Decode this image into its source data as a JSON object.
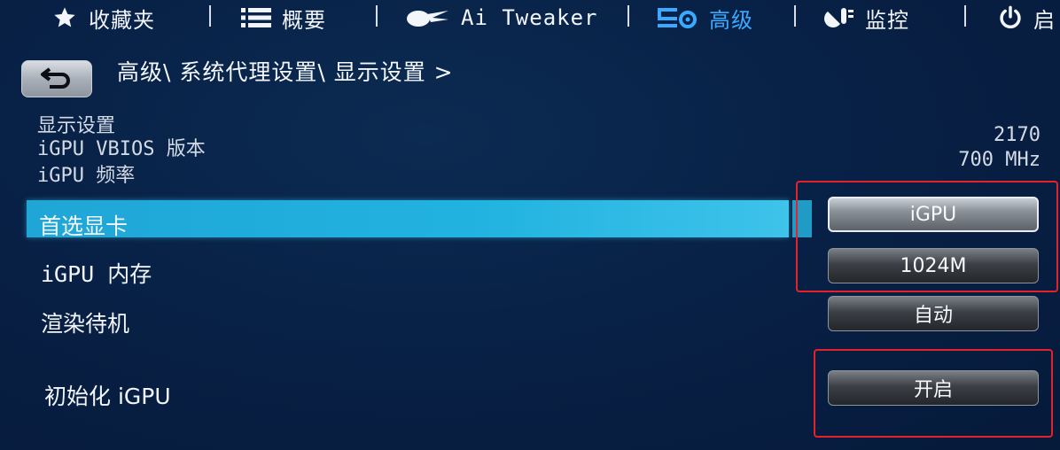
{
  "top_menu": {
    "items": [
      {
        "label": "收藏夹",
        "icon": "star-icon"
      },
      {
        "label": "概要",
        "icon": "list-icon"
      },
      {
        "label": "Ai Tweaker",
        "icon": "tweaker-icon"
      },
      {
        "label": "高级",
        "icon": "advanced-icon",
        "active": true
      },
      {
        "label": "监控",
        "icon": "monitor-icon"
      },
      {
        "label": "启",
        "icon": "power-icon"
      }
    ]
  },
  "breadcrumb": {
    "path": "高级\\ 系统代理设置\\ 显示设置 >"
  },
  "info": {
    "title": "显示设置",
    "rows": [
      {
        "label": "iGPU VBIOS 版本",
        "value": "2170"
      },
      {
        "label": "iGPU 频率",
        "value": "700 MHz"
      }
    ]
  },
  "settings": [
    {
      "label": "首选显卡",
      "value": "iGPU",
      "highlighted": true
    },
    {
      "label": "iGPU 内存",
      "value": "1024M"
    },
    {
      "label": "渲染待机",
      "value": "自动"
    },
    {
      "label": "初始化 iGPU",
      "value": "开启"
    }
  ],
  "colors": {
    "accent": "#3aa9ff",
    "highlight": "#22b3e0",
    "annotation": "#e8202a"
  }
}
